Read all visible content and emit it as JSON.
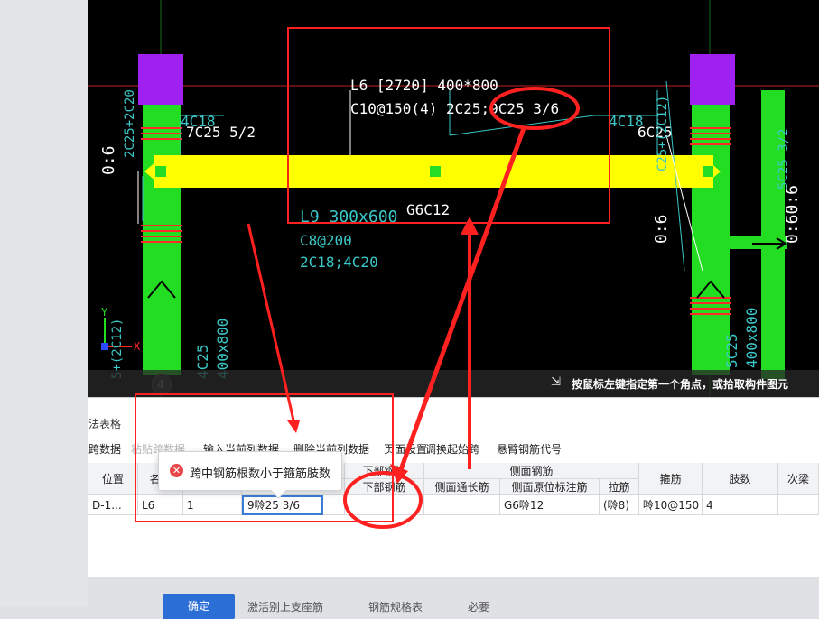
{
  "cad": {
    "beam_label": "L6 [2720] 400*800",
    "beam_rebar": "C10@150(4) 2C25;9C25 3/6",
    "top_left_rebar": "7C25 5/2",
    "top_right_rebar": "6C25",
    "left_c18": "4C18",
    "right_c18": "4C18",
    "beam_lower": "L9 300x600",
    "g_label": "G6C12",
    "c8": "C8@200",
    "c18c20": "2C18;4C20",
    "left_dim": "0:6",
    "right_dim": "0:6",
    "right_dim2": "0:6",
    "right_dim3": "0:60:6",
    "left_vert": "2C25+2C20",
    "left_col_a": "4C25",
    "left_col_b": "400x800",
    "right_col_a": "5C25",
    "right_col_b": "400x800",
    "right_vert_a": "C25+(2C12)",
    "right_vert_b": "5C25 3/2",
    "left_bottom_vert": "5+(2C12)",
    "circle_4": "4",
    "axis_x": "X",
    "axis_y": "Y"
  },
  "status_hint": "按鼠标左键指定第一个角点，或拾取构件图元",
  "status_icon": "corner-select-icon",
  "panel": {
    "title": "法表格",
    "toolbar": [
      {
        "label": "跨数据",
        "enabled": true
      },
      {
        "label": "粘贴跨数据",
        "enabled": false
      },
      {
        "label": "输入当前列数据",
        "enabled": true
      },
      {
        "label": "删除当前列数据",
        "enabled": true
      },
      {
        "label": "页面设置",
        "enabled": true
      },
      {
        "label": "调换起始跨",
        "enabled": true
      },
      {
        "label": "悬臂钢筋代号",
        "enabled": true
      }
    ],
    "headers": {
      "position": "位置",
      "name": "名称",
      "span": "跨号",
      "bottom_rebar_group": "下部钢筋",
      "bottom_rebar": "下部钢筋",
      "side_group": "侧面钢筋",
      "side_long": "侧面通长筋",
      "side_orig": "侧面原位标注筋",
      "tie": "拉筋",
      "stirrup": "箍筋",
      "legs": "肢数",
      "secondary": "次梁"
    },
    "row": {
      "position": "D-1...",
      "name": "L6",
      "span": "1",
      "editing_value": "9唥25 3/6",
      "bottom_rebar": "",
      "side_long": "",
      "side_orig": "G6唥12",
      "tie": "(唥8)",
      "stirrup": "唥10@150",
      "legs": "4",
      "secondary": ""
    }
  },
  "tooltip": {
    "icon": "error-icon",
    "message": "跨中钢筋根数小于箍筋肢数"
  },
  "footer": {
    "primary": "确定",
    "opt1": "激活别上支座筋",
    "opt2": "钢筋规格表",
    "opt3": "必要"
  },
  "colors": {
    "beam_yellow": "#ffff00",
    "column_green": "#22dd22",
    "cyan": "#3cc8c8",
    "red": "#ff2a2a",
    "purple": "#a020f0"
  }
}
